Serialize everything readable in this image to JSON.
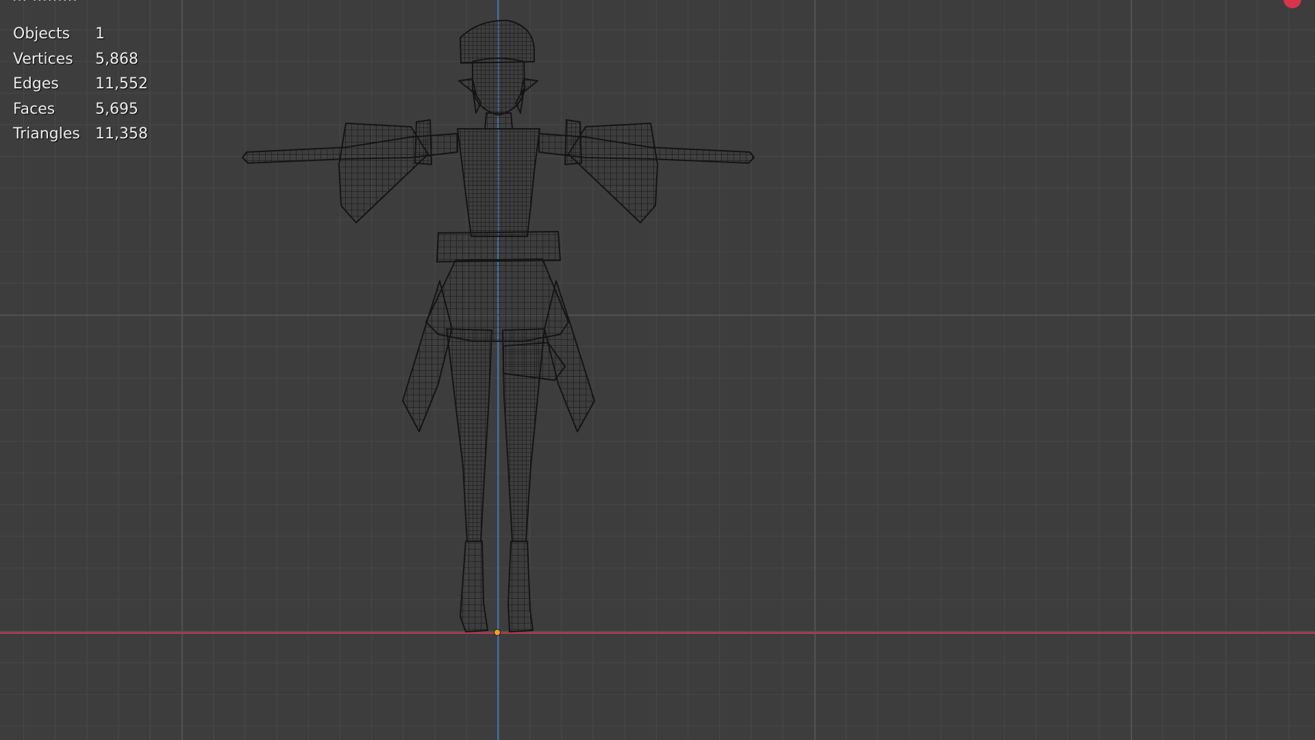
{
  "viewport": {
    "title": "···  ·········",
    "colors": {
      "background": "#3d3d3d",
      "grid_minor": "#484848",
      "grid_major": "#525252",
      "x_axis": "#c2364a",
      "y_axis": "#3b6fb0",
      "origin": "#f2a21e",
      "wire": "#141414"
    }
  },
  "stats": {
    "rows": [
      {
        "label": "Objects",
        "value": "1"
      },
      {
        "label": "Vertices",
        "value": "5,868"
      },
      {
        "label": "Edges",
        "value": "11,552"
      },
      {
        "label": "Faces",
        "value": "5,695"
      },
      {
        "label": "Triangles",
        "value": "11,358"
      }
    ]
  },
  "scene": {
    "object_icon": "wireframe-character-mesh",
    "origin_icon": "origin-point-icon",
    "gizmo_icon": "navigation-gizmo-icon"
  }
}
